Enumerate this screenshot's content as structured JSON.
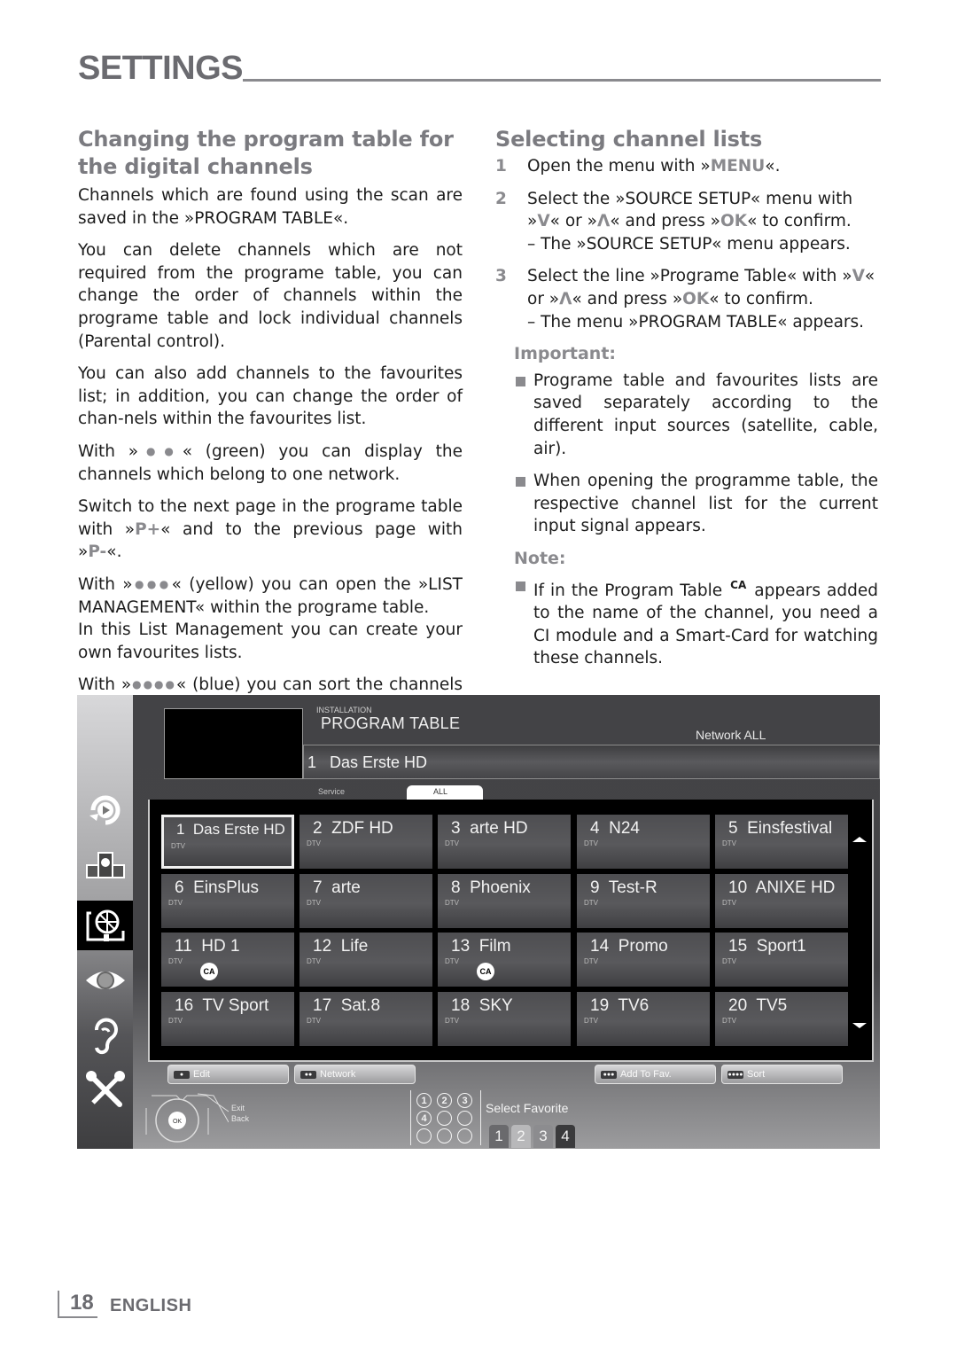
{
  "header": {
    "title": "SETTINGS"
  },
  "left": {
    "heading": "Changing the program table for the digital channels",
    "p1": "Channels which are found using the scan are saved in the »PROGRAM TABLE«.",
    "p2": "You can delete channels which are not required from the programe table, you can change the order of channels within the programe table and lock individual channels (Parental control).",
    "p3": "You can also add channels to the favourites list; in addition, you can change the order of chan-nels within the favourites list.",
    "p4_pre": "With »",
    "p4_dots": "●●",
    "p4_post": "« (green) you can display the channels which belong to one network.",
    "p5_pre": "Switch to the next page in the programe table with »",
    "p5_key1": "P+",
    "p5_mid": "« and to the previous page with »",
    "p5_key2": "P-",
    "p5_post": "«.",
    "p6_pre": "With »",
    "p6_dots": "●●●",
    "p6_post": "« (yellow) you can open the »LIST MANAGEMENT« within the programe table.",
    "p7": "In this List Management you can create your own favourites lists.",
    "p8_pre": "With »",
    "p8_dots": "●●●●",
    "p8_post": "« (blue) you can sort the channels ac-cording different criteria."
  },
  "right": {
    "heading": "Selecting channel lists",
    "steps": [
      {
        "num": "1",
        "pre": "Open the menu with »",
        "key": "MENU",
        "post": "«."
      },
      {
        "num": "2",
        "pre": "Select the »SOURCE SETUP« menu with »",
        "key_down": "V",
        "mid1": "« or »",
        "key_up": "Λ",
        "mid2": "« and press »",
        "key_ok": "OK",
        "post": "« to confirm.",
        "result": "– The »SOURCE SETUP« menu appears."
      },
      {
        "num": "3",
        "pre": "Select the line »Programe Table« with »",
        "key_down": "V",
        "mid1": "« or »",
        "key_up": "Λ",
        "mid2": "« and press »",
        "key_ok": "OK",
        "post": "« to confirm.",
        "result": "– The menu »PROGRAM TABLE« appears."
      }
    ],
    "important_label": "Important:",
    "important": [
      "Programe table and favourites lists are saved separately according to the different input sources (satellite, cable, air).",
      "When opening the programme table, the respective channel list for the current input signal appears."
    ],
    "note_label": "Note:",
    "note_pre": "If in the Program Table ",
    "note_badge": "CA",
    "note_post": " appears added to the name of the channel, you need a CI module and a Smart-Card for watching these channels."
  },
  "tv": {
    "breadcrumb": "INSTALLATION",
    "title": "PROGRAM TABLE",
    "network": "Network ALL",
    "current_channel": "1   Das Erste HD",
    "tabs": {
      "service": "Service",
      "all": "ALL"
    },
    "channels": [
      {
        "label": "1  Das Erste HD",
        "type": "DTV",
        "ca": false,
        "selected": true
      },
      {
        "label": "2  ZDF HD",
        "type": "DTV",
        "ca": false
      },
      {
        "label": "3  arte HD",
        "type": "DTV",
        "ca": false
      },
      {
        "label": "4  N24",
        "type": "DTV",
        "ca": false
      },
      {
        "label": "5  Einsfestival",
        "type": "DTV",
        "ca": false
      },
      {
        "label": "6  EinsPlus",
        "type": "DTV",
        "ca": false
      },
      {
        "label": "7  arte",
        "type": "DTV",
        "ca": false
      },
      {
        "label": "8  Phoenix",
        "type": "DTV",
        "ca": false
      },
      {
        "label": "9  Test-R",
        "type": "DTV",
        "ca": false
      },
      {
        "label": "10  ANIXE HD",
        "type": "DTV",
        "ca": false
      },
      {
        "label": "11  HD 1",
        "type": "DTV",
        "ca": true
      },
      {
        "label": "12  Life",
        "type": "DTV",
        "ca": false
      },
      {
        "label": "13  Film",
        "type": "DTV",
        "ca": true
      },
      {
        "label": "14  Promo",
        "type": "DTV",
        "ca": false
      },
      {
        "label": "15  Sport1",
        "type": "DTV",
        "ca": false
      },
      {
        "label": "16  TV Sport",
        "type": "DTV",
        "ca": false
      },
      {
        "label": "17  Sat.8",
        "type": "DTV",
        "ca": false
      },
      {
        "label": "18  SKY",
        "type": "DTV",
        "ca": false
      },
      {
        "label": "19  TV6",
        "type": "DTV",
        "ca": false
      },
      {
        "label": "20  TV5",
        "type": "DTV",
        "ca": false
      }
    ],
    "ca_badge": "CA",
    "buttons": {
      "edit": {
        "key": "●",
        "label": "Edit"
      },
      "network": {
        "key": "●●",
        "label": "Network"
      },
      "add_fav": {
        "key": "●●●",
        "label": "Add To Fav."
      },
      "sort": {
        "key": "●●●●",
        "label": "Sort"
      }
    },
    "remote": {
      "ok": "OK",
      "exit": "Exit",
      "back": "Back"
    },
    "numpad": [
      "1",
      "2",
      "3",
      "4",
      "",
      "",
      "",
      "",
      ""
    ],
    "favorite_label": "Select Favorite",
    "favorites": [
      "1",
      "2",
      "3",
      "4"
    ],
    "favorite_selected": "2",
    "sidebar": [
      "media-player",
      "network",
      "source-setup",
      "picture",
      "sound",
      "tools"
    ],
    "sidebar_active": "source-setup"
  },
  "footer": {
    "page": "18",
    "language": "ENGLISH"
  }
}
